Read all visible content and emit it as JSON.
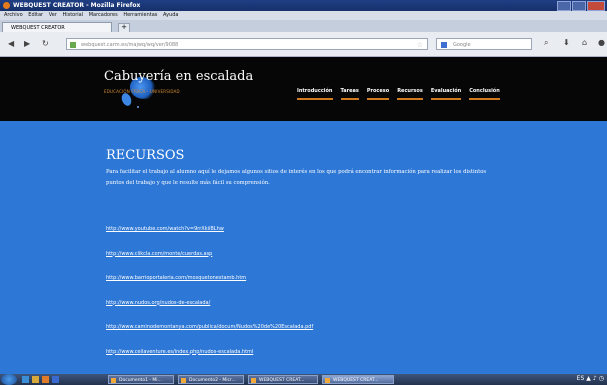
{
  "browser": {
    "window_title": "WEBQUEST CREATOR - Mozilla Firefox",
    "menu": [
      "Archivo",
      "Editar",
      "Ver",
      "Historial",
      "Marcadores",
      "Herramientas",
      "Ayuda"
    ],
    "tab_title": "WEBQUEST CREATOR",
    "new_tab": "+",
    "url": "webquest.carm.es/majwq/wq/ver/9088",
    "search_placeholder": "Google"
  },
  "site": {
    "title": "Cabuyería en escalada",
    "subtitle": "EDUCACIÓN FÍSICA - UNIVERSIDAD",
    "nav": [
      "Introducción",
      "Tareas",
      "Proceso",
      "Recursos",
      "Evaluación",
      "Conclusión"
    ]
  },
  "page": {
    "heading": "RECURSOS",
    "paragraph": "Para facilitar el trabajo al alumno aquí le dejamos algunos sitios de interés en los que podrá encontrar información para realizar los distintos puntos del trabajo y que le resulte más fácil su comprensión.",
    "links": [
      "http://www.youtube.com/watch?v=9rrXkiiBLhw",
      "http://www.clikcla.com/monte/cuerdas.asp",
      "http://www.barrioportaleria.com/mosquetonestamb.htm",
      "http://www.nudos.org/nudos-de-escalada/",
      "http://www.caminodemontanya.com/publica/docum/Nudos%20de%20Escalada.pdf",
      "http://www.ceilaventure.es/index.php/nudos-escalada.html"
    ]
  },
  "taskbar": {
    "items": [
      "Documento1 - Mi...",
      "Documento2 - Micr...",
      "WEBQUEST CREAT...",
      "WEBQUEST CREAT..."
    ],
    "tray": "ES"
  },
  "colors": {
    "page_bg": "#2d77d6",
    "header_bg": "#060606",
    "nav_underline": "#cf7a1d"
  }
}
